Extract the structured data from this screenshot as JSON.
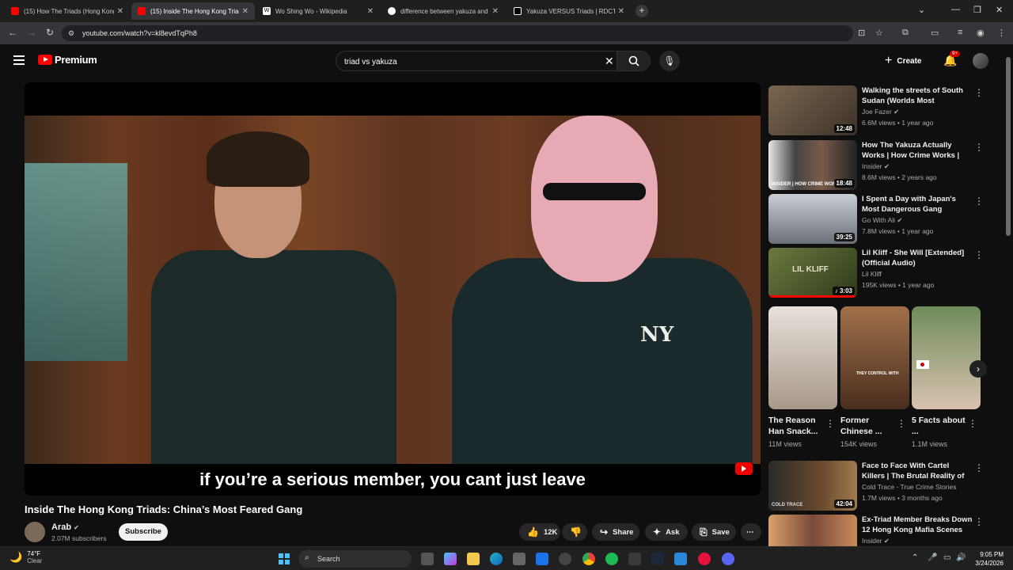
{
  "browser": {
    "tabs": [
      {
        "title": "(15) How The Triads (Hong Kong",
        "favicon_color": "#ff0000",
        "active": false
      },
      {
        "title": "(15) Inside The Hong Kong Triads",
        "favicon_color": "#ff0000",
        "active": true
      },
      {
        "title": "Wo Shing Wo - Wikipedia",
        "favicon_color": "#ffffff",
        "active": false
      },
      {
        "title": "difference between yakuza and",
        "favicon_color": "#4285f4",
        "active": false
      },
      {
        "title": "Yakuza VERSUS Triads | RDCTD",
        "favicon_color": "#ffffff",
        "active": false
      }
    ],
    "url": "youtube.com/watch?v=kl8evdTqPh8"
  },
  "youtube": {
    "logo_text": "Premium",
    "search_query": "triad vs yakuza",
    "create_label": "Create",
    "notifications_badge": "9+",
    "video": {
      "caption": "if you’re a serious member, you cant just leave",
      "title": "Inside The Hong Kong Triads: China’s Most Feared Gang",
      "channel": "Arab",
      "subscribers": "2.07M subscribers",
      "subscribe_label": "Subscribe",
      "likes": "12K",
      "share_label": "Share",
      "ask_label": "Ask",
      "save_label": "Save"
    },
    "recommendations": [
      {
        "title": "Walking the streets of South Sudan (Worlds Most Dangerou...",
        "channel": "Joe Fazer",
        "verified": true,
        "views": "6.6M views",
        "age": "1 year ago",
        "duration": "12:48",
        "thumb_color": "#5a4a3a"
      },
      {
        "title": "How The Yakuza Actually Works | How Crime Works | Insider",
        "channel": "Insider",
        "verified": true,
        "views": "8.6M views",
        "age": "2 years ago",
        "duration": "18:48",
        "thumb_color": "#3a3a3a"
      },
      {
        "title": "I Spent a Day with Japan's Most Dangerous Gang (Yakuza)",
        "title_suffix": "JP",
        "channel": "Go With Ali",
        "verified": true,
        "views": "7.8M views",
        "age": "1 year ago",
        "duration": "39:25",
        "thumb_color": "#8a8f96"
      },
      {
        "title": "Lil Kliff - She Will [Extended] (Official Audio)",
        "channel": "Lil Kliff",
        "verified": false,
        "views": "195K views",
        "age": "1 year ago",
        "duration": "3:03",
        "thumb_color": "#4a5a2e",
        "thumb_text": "LIL KLIFF",
        "progress": 0.98
      },
      {
        "title": "Face to Face With Cartel Killers | The Brutal Reality of Mexico's ...",
        "channel": "Cold Trace - True Crime Stories",
        "verified": false,
        "views": "1.7M views",
        "age": "3 months ago",
        "duration": "42:04",
        "thumb_color": "#4a3a2a",
        "thumb_text": "COLD TRACE"
      },
      {
        "title": "Ex-Triad Member Breaks Down 12 Hong Kong Mafia Scenes I...",
        "channel": "Insider",
        "verified": true,
        "views": "",
        "age": "",
        "duration": "",
        "thumb_color": "#6a4a3a"
      }
    ],
    "shorts": [
      {
        "title": "The Reason Han Snack...",
        "views": "11M views",
        "thumb_color": "#c8b8a8"
      },
      {
        "title": "Former Chinese ...",
        "views": "154K views",
        "thumb_color": "#8a5a3a",
        "thumb_text": "THEY CONTROL WITH"
      },
      {
        "title": "5 Facts about ...",
        "views": "1.1M views",
        "thumb_color": "#5a7a5a"
      }
    ]
  },
  "taskbar": {
    "temperature": "74°F",
    "weather": "Clear",
    "search_label": "Search",
    "time": "9:05 PM",
    "date": "3/24/2026"
  }
}
